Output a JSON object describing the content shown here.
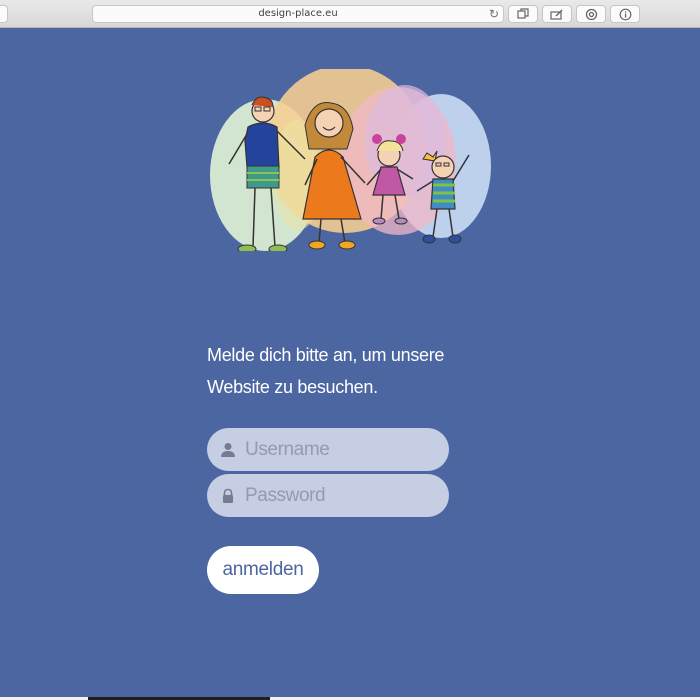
{
  "browser": {
    "url": "design-place.eu"
  },
  "login": {
    "intro": "Melde dich bitte an, um unsere Website zu besuchen.",
    "username_placeholder": "Username",
    "password_placeholder": "Password",
    "submit_label": "anmelden"
  },
  "colors": {
    "background": "#4c66a2",
    "input_bg": "#c6cee3",
    "button_bg": "#ffffff",
    "button_text": "#4c66a2"
  },
  "icons": {
    "username": "user-icon",
    "password": "lock-icon",
    "reload": "reload-icon",
    "tabs": "tabs-icon",
    "markup": "markup-icon",
    "settings": "gear-icon",
    "info": "info-icon"
  }
}
